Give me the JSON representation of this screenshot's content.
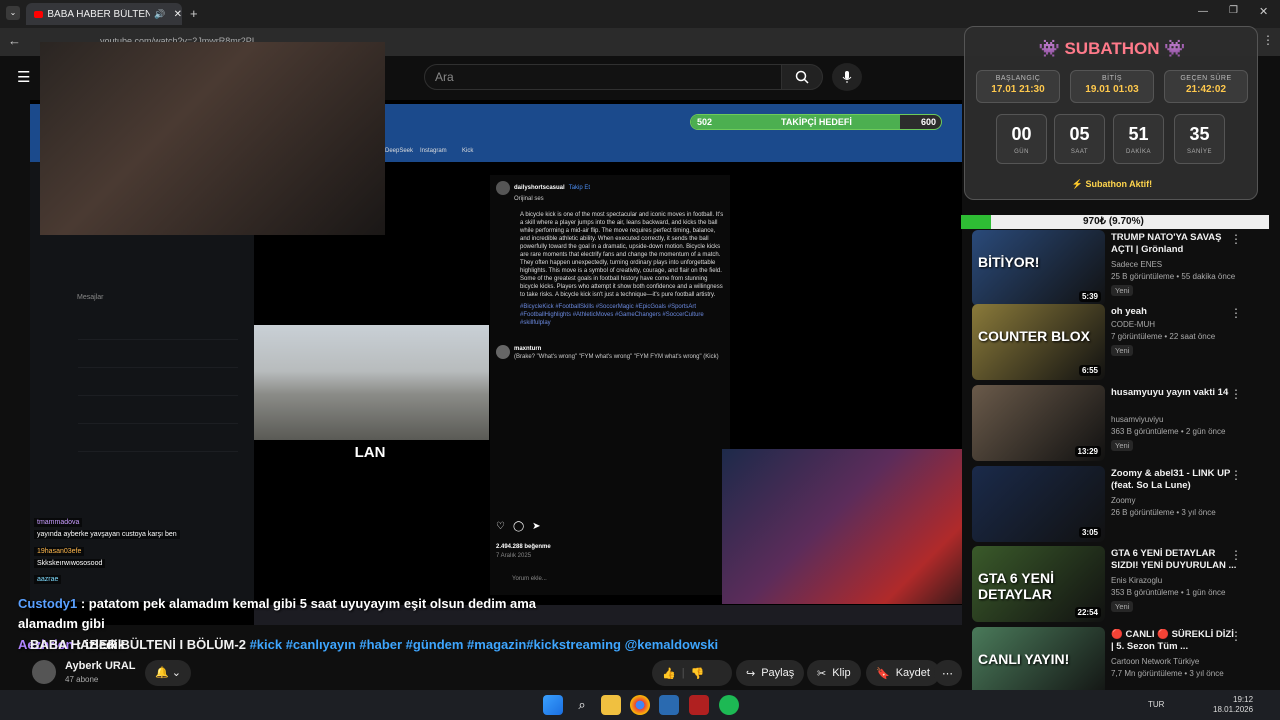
{
  "browser": {
    "tab_title": "BABA HABER BÜLTENİ I BÖ",
    "url": "youtube.com/watch?v=2JmwrR8mr2PI"
  },
  "header": {
    "search_placeholder": "Ara"
  },
  "follow_goal": {
    "label": "TAKİPÇİ HEDEFİ",
    "current": "502",
    "target": "600",
    "fraction": 0.837
  },
  "subathon": {
    "title": "SUBATHON",
    "start_label": "BAŞLANGIÇ",
    "start_value": "17.01 21:30",
    "end_label": "BİTİŞ",
    "end_value": "19.01 01:03",
    "elapsed_label": "GEÇEN SÜRE",
    "elapsed_value": "21:42:02",
    "days": "00",
    "days_label": "GÜN",
    "hours": "05",
    "hours_label": "SAAT",
    "minutes": "51",
    "minutes_label": "DAKİKA",
    "seconds": "35",
    "seconds_label": "SANİYE",
    "status": "⚡ Subathon Aktif!"
  },
  "progress_970": {
    "label": "970₺ (9.70%)",
    "fraction": 0.097
  },
  "overlay": {
    "clip_label": "LAN",
    "chat_small": [
      {
        "user": "tmammadova",
        "text": "yayında ayberke yavşayan custoya karşı ben"
      },
      {
        "user": "19hasan03efe",
        "text": "Skkskeırwıwososood"
      },
      {
        "user": "aazrae",
        "text": ""
      }
    ],
    "chat_main_user": "Custody1",
    "chat_main_text": ": patatom pek alamadım kemal gibi 5 saat uyuyayım eşit olsun dedim ama alamadım gibi",
    "chat_second_user": "Aezhrion",
    "chat_second_text": ": izledik",
    "insta": {
      "user": "dailyshortscasual",
      "follow": "Takip Et",
      "audio": "Orijinal ses",
      "caption": "A bicycle kick is one of the most spectacular and iconic moves in football. It's a skill where a player jumps into the air, leans backward, and kicks the ball while performing a mid-air flip. The move requires perfect timing, balance, and incredible athletic ability. When executed correctly, it sends the ball powerfully toward the goal in a dramatic, upside-down motion. Bicycle kicks are rare moments that electrify fans and change the momentum of a match. They often happen unexpectedly, turning ordinary plays into unforgettable highlights. This move is a symbol of creativity, courage, and flair on the field. Some of the greatest goals in football history have come from stunning bicycle kicks. Players who attempt it show both confidence and a willingness to take risks. A bicycle kick isn't just a technique—it's pure football artistry.",
      "tags": "#BicycleKick #FootballSkills #SoccerMagic #EpicGoals #SportsArt #FootballHighlights #AthleticMoves #GameChangers #SoccerCulture #skillfulplay",
      "likes": "2.494.288 beğenme",
      "date": "7 Aralık 2025",
      "comment_user": "maxnturn",
      "comment_text": "(Brake? \"What's wrong\" \"FYM what's wrong\" \"FYM FYM what's wrong\" (Kick)",
      "comment_input": "Yorum ekle..."
    }
  },
  "video": {
    "title": "BABA HABER BÜLTENİ I BÖLÜM-2",
    "tags": "#kick #canlıyayın #haber #gündem #magazin#kickstreaming @kemaldowski",
    "channel": "Ayberk URAL",
    "subs": "47 abone",
    "share": "Paylaş",
    "clip": "Klip",
    "save": "Kaydet"
  },
  "recommended": [
    {
      "title": "TRUMP NATO'YA SAVAŞ AÇTI | Grönland",
      "channel": "Sadece ENES",
      "meta": "25 B görüntüleme • 55 dakika önce",
      "badge": "Yeni",
      "duration": "5:39",
      "thumb_text": "BİTİYOR!",
      "color": "#2a4a7a"
    },
    {
      "title": "oh yeah",
      "channel": "CODE-MUH",
      "meta": "7 görüntüleme • 22 saat önce",
      "badge": "Yeni",
      "duration": "6:55",
      "thumb_text": "COUNTER BLOX",
      "color": "#8a7a3a"
    },
    {
      "title": "husamyuyu yayın vakti 14",
      "channel": "husamviyuviyu",
      "meta": "363 B görüntüleme • 2 gün önce",
      "badge": "Yeni",
      "duration": "13:29",
      "thumb_text": "",
      "color": "#6a5a4a"
    },
    {
      "title": "Zoomy & abel31 - LINK UP (feat. So La Lune)",
      "channel": "Zoomy",
      "meta": "26 B görüntüleme • 3 yıl önce",
      "badge": "",
      "duration": "3:05",
      "thumb_text": "",
      "color": "#1a2a4a"
    },
    {
      "title": "GTA 6 YENİ DETAYLAR SIZDI! YENİ DUYURULAN ...",
      "channel": "Enis Kirazoglu",
      "meta": "353 B görüntüleme • 1 gün önce",
      "badge": "Yeni",
      "duration": "22:54",
      "thumb_text": "GTA 6 YENİ DETAYLAR",
      "color": "#3a5a2a"
    },
    {
      "title": "🔴 CANLI 🔴 SÜREKLİ DİZİ | 5. Sezon Tüm ...",
      "channel": "Cartoon Network Türkiye",
      "meta": "7,7 Mn görüntüleme • 3 yıl önce",
      "badge": "",
      "duration": "",
      "thumb_text": "CANLI YAYIN!",
      "color": "#4a7a5a"
    }
  ],
  "taskbar": {
    "lang": "TUR",
    "time": "19:12",
    "date": "18.01.2026"
  }
}
